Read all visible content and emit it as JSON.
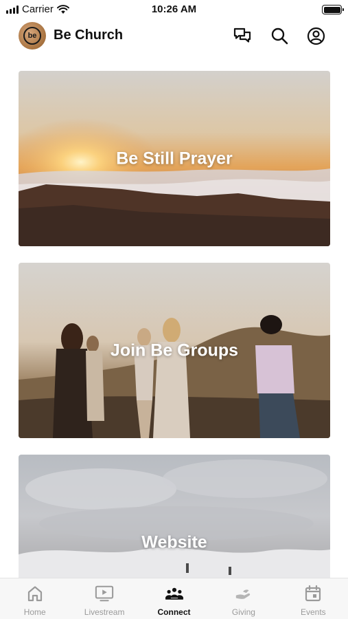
{
  "status_bar": {
    "carrier": "Carrier",
    "time": "10:26 AM"
  },
  "header": {
    "app_name": "Be Church",
    "logo_text": "be"
  },
  "cards": [
    {
      "label": "Be Still Prayer"
    },
    {
      "label": "Join Be Groups"
    },
    {
      "label": "Website"
    }
  ],
  "tab_bar": {
    "tabs": [
      {
        "label": "Home",
        "icon": "home-icon"
      },
      {
        "label": "Livestream",
        "icon": "tv-play-icon"
      },
      {
        "label": "Connect",
        "icon": "people-group-icon",
        "active": true
      },
      {
        "label": "Giving",
        "icon": "giving-hand-icon"
      },
      {
        "label": "Events",
        "icon": "calendar-icon"
      }
    ]
  },
  "colors": {
    "active_tab": "#111111",
    "inactive_tab": "#9a9a9a",
    "tab_bar_bg": "#f7f7f7"
  }
}
